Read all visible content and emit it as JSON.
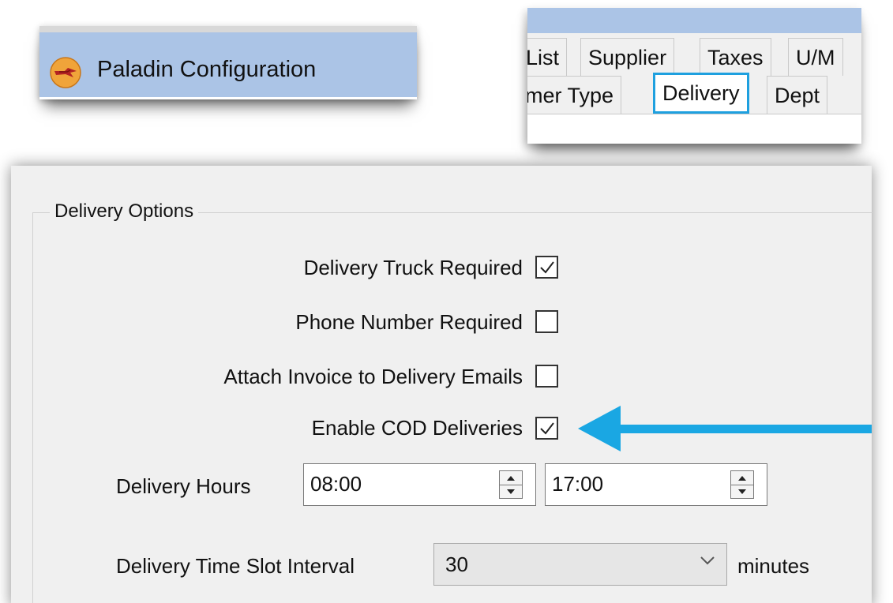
{
  "title_bar": {
    "app_title": "Paladin Configuration",
    "bar_color": "#abc4e6",
    "logo_icon": "paladin-logo-icon"
  },
  "tabs": {
    "row1": [
      "List",
      "Supplier",
      "Taxes",
      "U/M"
    ],
    "row2": [
      "mer Type",
      "Delivery",
      "Dept"
    ],
    "selected": "Delivery",
    "highlight_color": "#1ea0df"
  },
  "delivery_options": {
    "group_title": "Delivery Options",
    "options": [
      {
        "label": "Delivery Truck Required",
        "checked": true
      },
      {
        "label": "Phone Number Required",
        "checked": false
      },
      {
        "label": "Attach Invoice to Delivery Emails",
        "checked": false
      },
      {
        "label": "Enable COD Deliveries",
        "checked": true
      }
    ],
    "hours": {
      "label": "Delivery Hours",
      "start": "08:00",
      "end": "17:00"
    },
    "time_slot": {
      "label": "Delivery Time Slot Interval",
      "value": "30",
      "unit": "minutes"
    }
  },
  "annotation": {
    "arrow_color": "#1aa7e3",
    "points_to": "Enable COD Deliveries"
  }
}
